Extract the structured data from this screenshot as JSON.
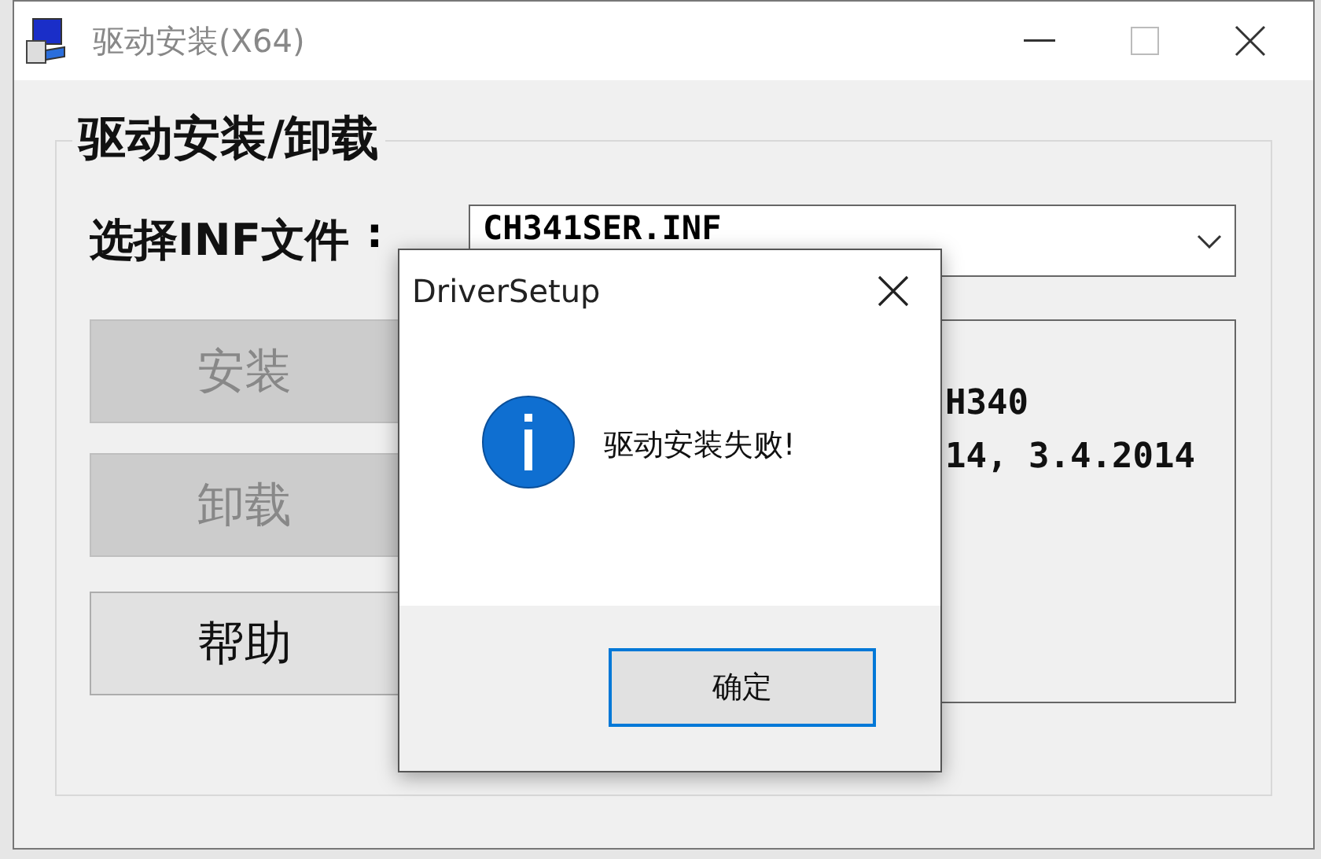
{
  "window": {
    "title": "驱动安装(X64)"
  },
  "group": {
    "label": "驱动安装/卸载"
  },
  "inf": {
    "label": "选择INF文件",
    "separator": ":",
    "value": "CH341SER.INF"
  },
  "buttons": [
    {
      "label": "安装",
      "disabled": true
    },
    {
      "label": "卸载",
      "disabled": true
    },
    {
      "label": "帮助",
      "disabled": false
    }
  ],
  "info": {
    "lines": [
      "H340",
      "14, 3.4.2014"
    ]
  },
  "dialog": {
    "title": "DriverSetup",
    "kind": "info",
    "message": "驱动安装失败!",
    "buttons": [
      {
        "label": "确定",
        "default": true
      }
    ]
  }
}
